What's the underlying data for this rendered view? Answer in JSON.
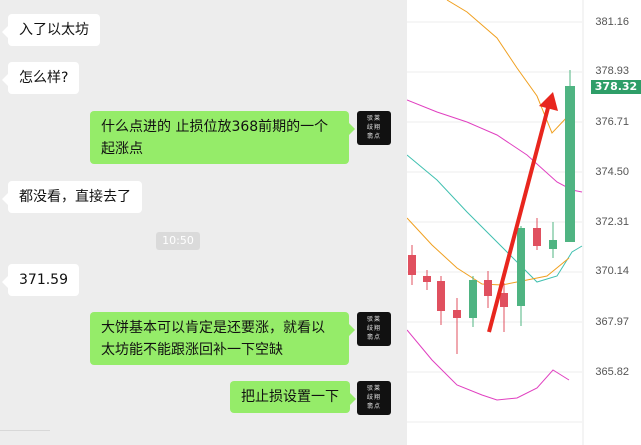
{
  "chat": {
    "messages": [
      {
        "side": "in",
        "text": "入了以太坊"
      },
      {
        "side": "in",
        "text": "怎么样?"
      },
      {
        "side": "out",
        "text": "什么点进的 止损位放368前期的一个起涨点"
      },
      {
        "side": "in",
        "text": "都没看，直接去了"
      },
      {
        "side": "in",
        "text": "371.59"
      },
      {
        "side": "out",
        "text": "大饼基本可以肯定是还要涨，就看以太坊能不能跟涨回补一下空缺"
      },
      {
        "side": "out",
        "text": "把止损设置一下"
      }
    ],
    "timestamp": "10:50",
    "avatar_seal_text": "驳莱歧翔 翡点来者"
  },
  "chart": {
    "price_axis": [
      "381.16",
      "378.93",
      "376.71",
      "374.50",
      "372.31",
      "370.14",
      "367.97",
      "365.82"
    ],
    "current_price": "378.32",
    "colors": {
      "up": "#4fb482",
      "down": "#e0505f",
      "ma_yellow": "#f0a020",
      "band_magenta": "#e040c0",
      "ma_teal": "#40c0b0",
      "arrow": "#e8261e"
    }
  }
}
